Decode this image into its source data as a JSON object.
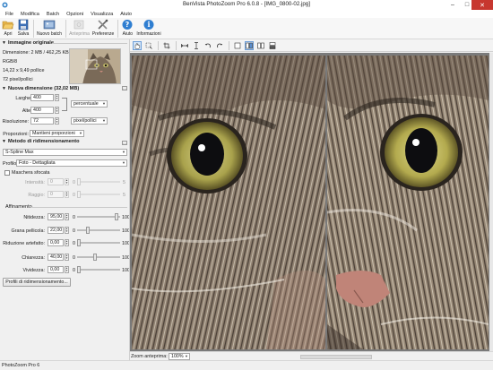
{
  "window": {
    "title": "BenVista PhotoZoom Pro 6.0.8 - [IMG_0800-02.jpg]"
  },
  "menu": [
    "File",
    "Modifica",
    "Batch",
    "Opzioni",
    "Visualizza",
    "Aiuto"
  ],
  "toolbar": {
    "open": "Apri",
    "save": "Salva",
    "new_batch": "Nuovo batch",
    "preview": "Anteprima",
    "preferences": "Preferenze",
    "help": "Aiuto",
    "info": "Informazioni"
  },
  "original_image": {
    "header": "Immagine originale",
    "dimension": "Dimensione: 2 MB / 462,25 KB",
    "color_mode": "RGB/8",
    "size_inches": "14,22 x 9,49 pollice",
    "resolution": "72 pixel/pollici"
  },
  "new_size": {
    "header": "Nuova dimensione (32,02 MB)",
    "width_label": "Larghezza:",
    "width_value": "400",
    "height_label": "Altezza:",
    "height_value": "400",
    "unit": "percentuale",
    "resolution_label": "Risoluzione:",
    "resolution_value": "72",
    "resolution_unit": "pixel/pollici",
    "proportions_label": "Proporzioni:",
    "proportions_value": "Mantieni proporzioni"
  },
  "method": {
    "header": "Metodo di ridimensionamento",
    "algorithm": "S-Spline Max",
    "profile_label": "Profilo:",
    "profile_value": "Foto - Dettagliata",
    "blur_mask_label": "Maschera sfocata",
    "intensity_label": "Intensità:",
    "intensity_value": "0",
    "intensity_min": "0",
    "intensity_max": "5",
    "radius_label": "Raggio:",
    "radius_value": "0",
    "radius_min": "0",
    "radius_max": "5",
    "refinement_header": "Affinamento",
    "sharpness_label": "Nitidezza:",
    "sharpness_value": "95,00",
    "grain_label": "Grana pellicola:",
    "grain_value": "22,00",
    "artifact_label": "Riduzione artefatto:",
    "artifact_value": "0,00",
    "brightness_label": "Chiarezza:",
    "brightness_value": "40,00",
    "vividness_label": "Vividezza:",
    "vividness_value": "0,00",
    "min": "0",
    "max": "100",
    "sharpness_level": 0.95,
    "grain_level": 0.22,
    "artifact_level": 0.0,
    "brightness_level": 0.4,
    "vividness_level": 0.0,
    "profiles_button": "Profili di ridimensionamento..."
  },
  "zoom": {
    "label": "Zoom anteprima:",
    "value": "100%"
  },
  "status": "PhotoZoom Pro 6",
  "icons": [
    "folder-open-icon",
    "save-icon",
    "new-batch-icon",
    "preview-icon",
    "preferences-icon",
    "help-icon",
    "info-icon"
  ]
}
